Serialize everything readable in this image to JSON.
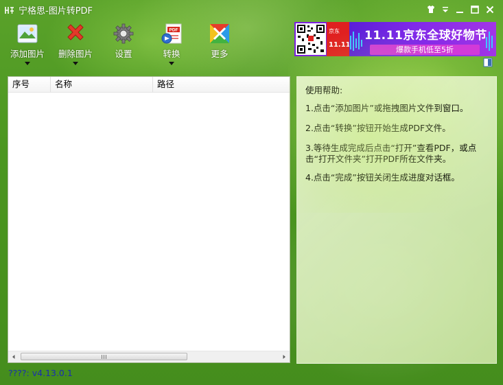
{
  "window": {
    "title": "宁格思-图片转PDF",
    "controls": [
      "skin-icon",
      "menu-icon",
      "minimize-icon",
      "maximize-icon",
      "close-icon"
    ]
  },
  "toolbar": {
    "add_label": "添加图片",
    "delete_label": "删除图片",
    "settings_label": "设置",
    "convert_label": "转换",
    "more_label": "更多"
  },
  "ad": {
    "brand": "京东",
    "badge": "11.11",
    "headline": "11.11京东全球好物节",
    "sub": "爆款手机低至5折"
  },
  "list": {
    "columns": [
      "序号",
      "名称",
      "路径"
    ],
    "rows": []
  },
  "help": {
    "title": "使用帮助:",
    "lines": [
      "1.点击“添加图片”或拖拽图片文件到窗口。",
      "2.点击“转换”按钮开始生成PDF文件。",
      "3.等待生成完成后点击“打开”查看PDF，或点击“打开文件夹”打开PDF所在文件夹。",
      "4.点击“完成”按钮关闭生成进度对话框。"
    ]
  },
  "status": {
    "version": "????: v4.13.0.1"
  },
  "colors": {
    "window_green": "#4f9a1f",
    "version_blue": "#1a2eb0",
    "ad_purple": "#7a1ee0",
    "ad_red": "#e02020"
  }
}
